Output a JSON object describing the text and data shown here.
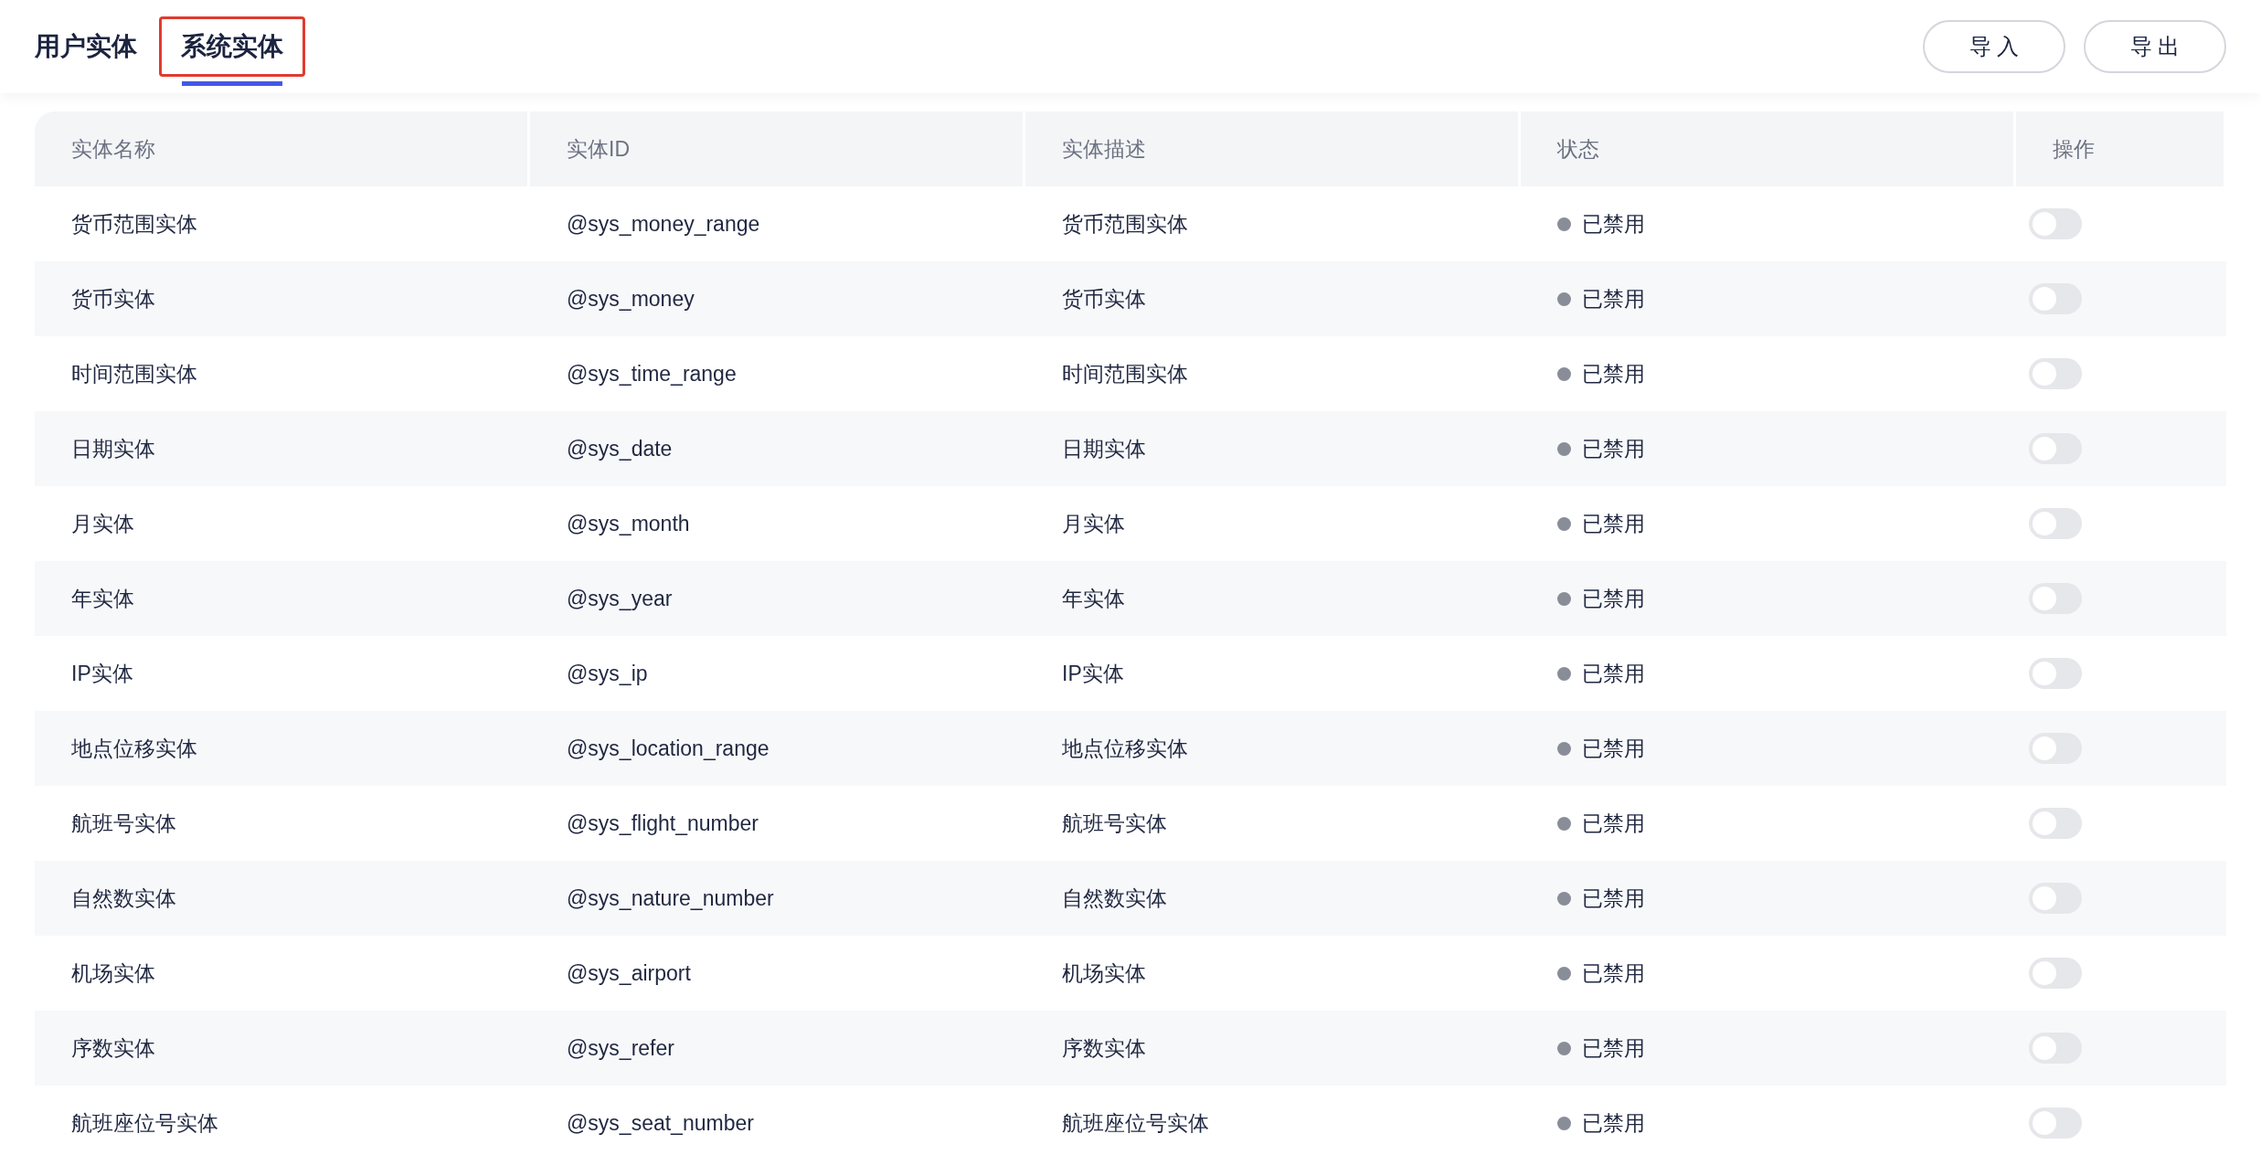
{
  "tabs": [
    {
      "label": "用户实体",
      "selected": false,
      "highlighted": false
    },
    {
      "label": "系统实体",
      "selected": true,
      "highlighted": true
    }
  ],
  "actions": [
    "导 入",
    "导 出"
  ],
  "table": {
    "columns": [
      "实体名称",
      "实体ID",
      "实体描述",
      "状态",
      "操作"
    ],
    "rows": [
      {
        "name": "货币范围实体",
        "id": "@sys_money_range",
        "description": "货币范围实体",
        "status": "已禁用",
        "enabled": false
      },
      {
        "name": "货币实体",
        "id": "@sys_money",
        "description": "货币实体",
        "status": "已禁用",
        "enabled": false
      },
      {
        "name": "时间范围实体",
        "id": "@sys_time_range",
        "description": "时间范围实体",
        "status": "已禁用",
        "enabled": false
      },
      {
        "name": "日期实体",
        "id": "@sys_date",
        "description": "日期实体",
        "status": "已禁用",
        "enabled": false
      },
      {
        "name": "月实体",
        "id": "@sys_month",
        "description": "月实体",
        "status": "已禁用",
        "enabled": false
      },
      {
        "name": "年实体",
        "id": "@sys_year",
        "description": "年实体",
        "status": "已禁用",
        "enabled": false
      },
      {
        "name": "IP实体",
        "id": "@sys_ip",
        "description": "IP实体",
        "status": "已禁用",
        "enabled": false
      },
      {
        "name": "地点位移实体",
        "id": "@sys_location_range",
        "description": "地点位移实体",
        "status": "已禁用",
        "enabled": false
      },
      {
        "name": "航班号实体",
        "id": "@sys_flight_number",
        "description": "航班号实体",
        "status": "已禁用",
        "enabled": false
      },
      {
        "name": "自然数实体",
        "id": "@sys_nature_number",
        "description": "自然数实体",
        "status": "已禁用",
        "enabled": false
      },
      {
        "name": "机场实体",
        "id": "@sys_airport",
        "description": "机场实体",
        "status": "已禁用",
        "enabled": false
      },
      {
        "name": "序数实体",
        "id": "@sys_refer",
        "description": "序数实体",
        "status": "已禁用",
        "enabled": false
      },
      {
        "name": "航班座位号实体",
        "id": "@sys_seat_number",
        "description": "航班座位号实体",
        "status": "已禁用",
        "enabled": false
      }
    ]
  }
}
